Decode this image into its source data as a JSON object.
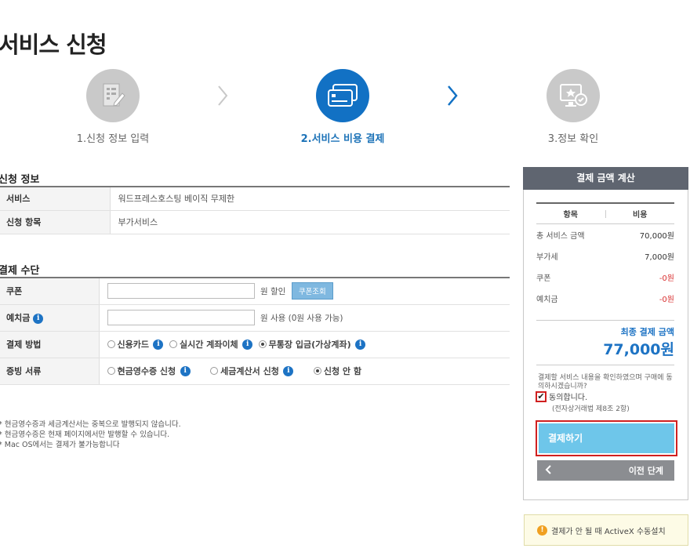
{
  "page": {
    "title": "서비스 신청"
  },
  "steps": [
    {
      "label": "1.신청 정보 입력",
      "icon": "document-edit-icon",
      "active": false
    },
    {
      "label": "2.서비스 비용 결제",
      "icon": "payment-card-icon",
      "active": true
    },
    {
      "label": "3.정보 확인",
      "icon": "monitor-check-icon",
      "active": false
    }
  ],
  "application_info": {
    "title": "신청 정보",
    "rows": [
      {
        "label": "서비스",
        "value": "워드프레스호스팅 베이직 무제한"
      },
      {
        "label": "신청 항목",
        "value": "부가서비스"
      }
    ]
  },
  "payment_method": {
    "title": "결제 수단",
    "coupon": {
      "label": "쿠폰",
      "value": "",
      "unit": "원 할인",
      "button": "쿠폰조회"
    },
    "deposit": {
      "label": "예치금",
      "value": "",
      "unit": "원 사용 (0원 사용 가능)"
    },
    "method": {
      "label": "결제 방법",
      "options": [
        "신용카드",
        "실시간 계좌이체",
        "무통장 입금(가상계좌)"
      ],
      "selected": "무통장 입금(가상계좌)"
    },
    "receipt": {
      "label": "증빙 서류",
      "options": [
        "현금영수증 신청",
        "세금계산서 신청",
        "신청 안 함"
      ],
      "selected": "신청 안 함"
    }
  },
  "notes": [
    "* 현금영수증과 세금계산서는 중복으로 발행되지 않습니다.",
    "* 현금영수증은 현재 페이지에서만 발행할 수 있습니다.",
    "* Mac OS에서는 결제가 불가능합니다"
  ],
  "summary": {
    "title": "결제 금액 계산",
    "col_item": "항목",
    "col_cost": "비용",
    "rows": [
      {
        "label": "총 서비스 금액",
        "value": "70,000원"
      },
      {
        "label": "부가세",
        "value": "7,000원"
      },
      {
        "label": "쿠폰",
        "value": "-0원"
      },
      {
        "label": "예치금",
        "value": "-0원"
      }
    ],
    "final_label": "최종 결제 금액",
    "final_amount": "77,000원",
    "confirm_question": "결제할 서비스 내용을 확인하였으며 구매에 동의하시겠습니까?",
    "agree_label": "동의합니다.",
    "agree_checked": true,
    "law_note": "(전자상거래법 제8조 2항)",
    "pay_button": "결제하기",
    "prev_button": "이전 단계"
  },
  "activex_note": "결제가 안 될 때 ActiveX 수동설치",
  "colors": {
    "accent": "#1271c4",
    "pay_button": "#6ec6ea",
    "highlight": "#d02020",
    "header": "#5f6570"
  }
}
